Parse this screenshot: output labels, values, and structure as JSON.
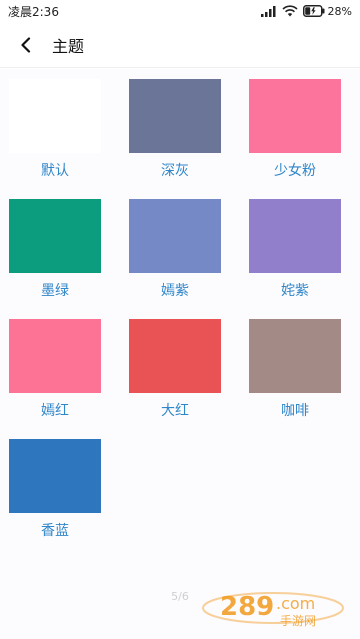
{
  "status_bar": {
    "time": "凌晨2:36",
    "battery": "28%"
  },
  "header": {
    "title": "主题"
  },
  "themes": [
    {
      "label": "默认",
      "color": "#ffffff"
    },
    {
      "label": "深灰",
      "color": "#6a7597"
    },
    {
      "label": "少女粉",
      "color": "#fc739b"
    },
    {
      "label": "墨绿",
      "color": "#0c9d7e"
    },
    {
      "label": "嫣紫",
      "color": "#7489c6"
    },
    {
      "label": "姹紫",
      "color": "#917fcc"
    },
    {
      "label": "嫣红",
      "color": "#fc7396"
    },
    {
      "label": "大红",
      "color": "#e95355"
    },
    {
      "label": "咖啡",
      "color": "#a38a86"
    },
    {
      "label": "香蓝",
      "color": "#2e77bf"
    }
  ],
  "pager": {
    "text": "5/6"
  },
  "watermark": {
    "text_main": "289.com",
    "text_sub": "手游网",
    "color": "#f19a1e"
  }
}
